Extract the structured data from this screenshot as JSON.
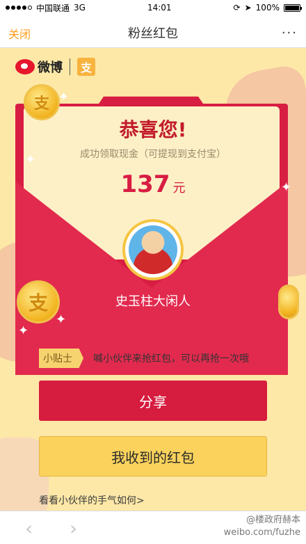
{
  "status_bar": {
    "carrier": "中国联通",
    "network": "3G",
    "time": "14:01",
    "battery": "100%",
    "battery_level": 1.0
  },
  "navbar": {
    "close_label": "关闭",
    "title": "粉丝红包",
    "more_label": "..."
  },
  "brand": {
    "weibo_label": "微博",
    "alipay_glyph": "支"
  },
  "card": {
    "congrats": "恭喜您!",
    "subtitle": "成功领取现金（可提现到支付宝）",
    "amount": "137",
    "unit": "元",
    "user_name": "史玉柱大闲人"
  },
  "coins": {
    "glyph": "支"
  },
  "tip": {
    "badge": "小贴士",
    "text": "喊小伙伴来抢红包，可以再抢一次哦"
  },
  "buttons": {
    "share": "分享",
    "received": "我收到的红包"
  },
  "link": {
    "luck": "看看小伙伴的手气如何>"
  },
  "bottom": {
    "back_glyph": "‹",
    "forward_glyph": "›",
    "watermark_line1": "@楼政府赫本",
    "watermark_line2": "weibo.com/fuzhe"
  },
  "colors": {
    "accent_orange": "#ff9d1a",
    "envelope_red": "#d81d43",
    "button_yellow": "#fbd35c",
    "background": "#fde8a8"
  }
}
